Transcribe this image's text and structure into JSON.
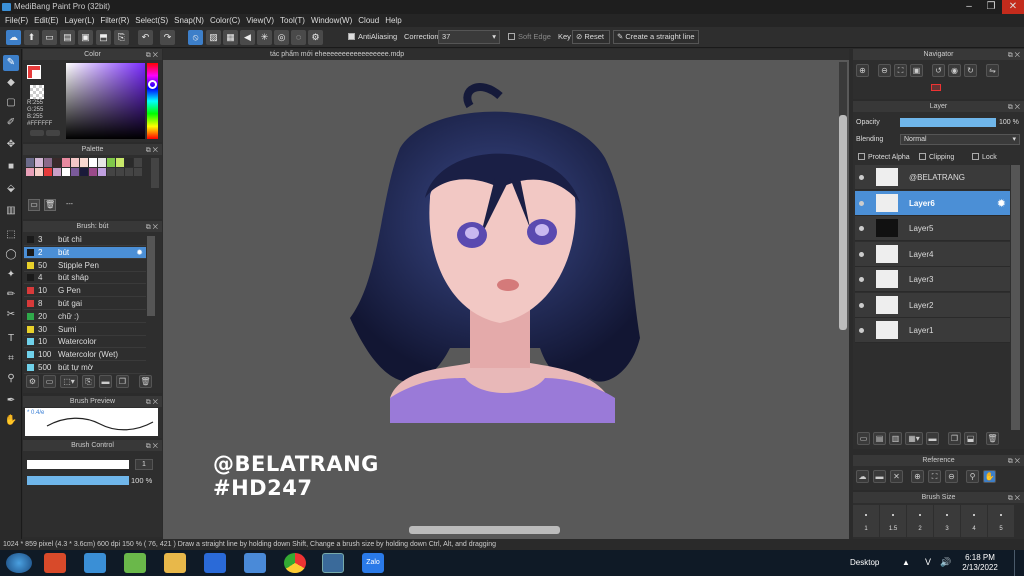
{
  "app": {
    "title": "MediBang Paint Pro (32bit)"
  },
  "menu": [
    "File(F)",
    "Edit(E)",
    "Layer(L)",
    "Filter(R)",
    "Select(S)",
    "Snap(N)",
    "Color(C)",
    "View(V)",
    "Tool(T)",
    "Window(W)",
    "Cloud",
    "Help"
  ],
  "toolbar": {
    "antialiasing_label": "AntiAliasing",
    "correction_label": "Correction",
    "correction_value": "37",
    "softedge_label": "Soft Edge",
    "key_label": "Key",
    "reset_label": "Reset",
    "straight_line_label": "Create a straight line"
  },
  "color_panel": {
    "title": "Color",
    "r": "R:255",
    "g": "G:255",
    "b": "B:255",
    "hex": "#FFFFFF"
  },
  "palette_panel": {
    "title": "Palette",
    "dash": "---"
  },
  "brush_panel": {
    "title": "Brush: bút",
    "items": [
      {
        "size": "3",
        "name": "bút chì",
        "color": "#1a1a1a"
      },
      {
        "size": "2",
        "name": "bút",
        "color": "#1a1a1a"
      },
      {
        "size": "50",
        "name": "Stipple Pen",
        "color": "#e8d02a"
      },
      {
        "size": "4",
        "name": "bút sháp",
        "color": "#1a1a1a"
      },
      {
        "size": "10",
        "name": "G Pen",
        "color": "#d83a3a"
      },
      {
        "size": "8",
        "name": "bút gai",
        "color": "#d83a3a"
      },
      {
        "size": "20",
        "name": "chữ :)",
        "color": "#2fa84a"
      },
      {
        "size": "30",
        "name": "Sumi",
        "color": "#e8d02a"
      },
      {
        "size": "10",
        "name": "Watercolor",
        "color": "#6fd1ea"
      },
      {
        "size": "100",
        "name": "Watercolor (Wet)",
        "color": "#6fd1ea"
      },
      {
        "size": "500",
        "name": "bút tự mờ",
        "color": "#6fd1ea"
      }
    ]
  },
  "brush_preview": {
    "title": "Brush Preview",
    "value": "* 0.4/e"
  },
  "brush_control": {
    "title": "Brush Control",
    "size": "1",
    "opacity": "100 %"
  },
  "canvas": {
    "tab_title": "tác phẩm mới eheeeeeeeeeeeeeeeee.mdp",
    "watermark_line1": "@BELATRANG",
    "watermark_line2": "#HD247"
  },
  "navigator": {
    "title": "Navigator"
  },
  "layer_panel": {
    "title": "Layer",
    "opacity_label": "Opacity",
    "opacity_value": "100 %",
    "blending_label": "Blending",
    "blending_value": "Normal",
    "protect_alpha": "Protect Alpha",
    "clipping": "Clipping",
    "lock": "Lock",
    "layers": [
      {
        "name": "@BELATRANG"
      },
      {
        "name": "Layer6"
      },
      {
        "name": "Layer5"
      },
      {
        "name": "Layer4"
      },
      {
        "name": "Layer3"
      },
      {
        "name": "Layer2"
      },
      {
        "name": "Layer1"
      }
    ]
  },
  "reference_panel": {
    "title": "Reference"
  },
  "brush_size_panel": {
    "title": "Brush Size",
    "sizes": [
      "1",
      "1.5",
      "2",
      "3",
      "4",
      "5"
    ]
  },
  "status": {
    "text": "1024 * 859 pixel   (4.3 * 3.6cm)   600 dpi   150 %   ( 76, 421 )   Draw a straight line by holding down Shift, Change a brush size by holding down Ctrl, Alt, and dragging"
  },
  "taskbar": {
    "desktop_label": "Desktop",
    "time": "6:18 PM",
    "date": "2/13/2022",
    "zalo_label": "Zalo",
    "lang": "V"
  }
}
